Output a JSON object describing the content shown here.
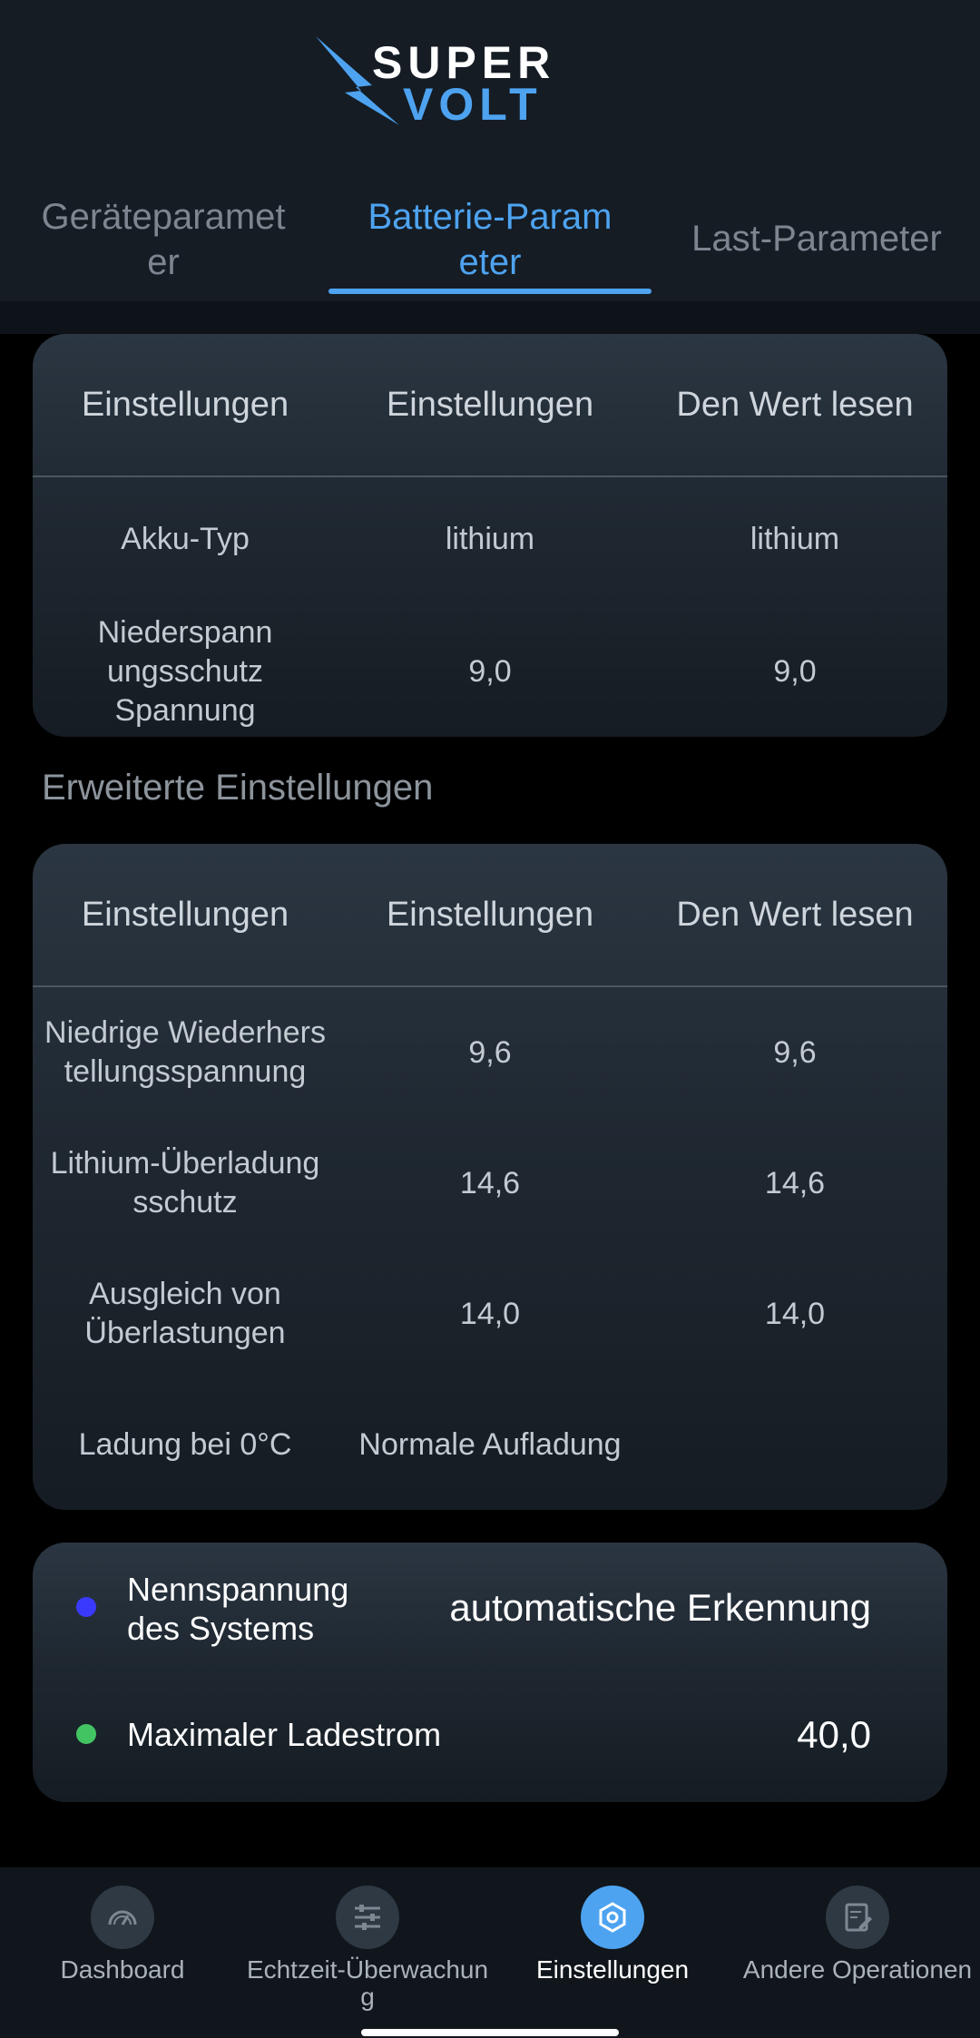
{
  "colors": {
    "accent": "#4ea3f0",
    "header_bg": "#151c24",
    "page_bg": "#000000",
    "dot_voltage": "#3a3aff",
    "dot_current": "#43c463"
  },
  "header": {
    "logo_text": "SUPER VOLT",
    "tabs": [
      {
        "label": "Geräteparameter",
        "line1": "Geräteparamet",
        "line2": "er",
        "active": false
      },
      {
        "label": "Batterie-Parameter",
        "line1": "Batterie-Param",
        "line2": "eter",
        "active": true
      },
      {
        "label": "Last-Parameter",
        "line1": "Last-Parameter",
        "line2": "",
        "active": false
      }
    ]
  },
  "basic_table": {
    "headers": [
      "Einstellungen",
      "Einstellungen",
      "Den Wert lesen"
    ],
    "rows": [
      {
        "name": "Akku-Typ",
        "setting": "lithium",
        "read": "lithium"
      },
      {
        "name": "Niederspann ungsschutz Spannung",
        "name_lines": [
          "Niederspann",
          "ungsschutz",
          "Spannung"
        ],
        "setting": "9,0",
        "read": "9,0"
      }
    ]
  },
  "advanced_section": {
    "title": "Erweiterte Einstellungen"
  },
  "advanced_table": {
    "headers": [
      "Einstellungen",
      "Einstellungen",
      "Den Wert lesen"
    ],
    "rows": [
      {
        "name_lines": [
          "Niedrige Wiederhers",
          "tellungsspannung"
        ],
        "setting": "9,6",
        "read": "9,6"
      },
      {
        "name_lines": [
          "Lithium-Überladung",
          "sschutz"
        ],
        "setting": "14,6",
        "read": "14,6"
      },
      {
        "name_lines": [
          "Ausgleich von",
          "Überlastungen"
        ],
        "setting": "14,0",
        "read": "14,0"
      },
      {
        "name_lines": [
          "Ladung bei 0°C"
        ],
        "setting": "Normale Aufladung",
        "read": ""
      }
    ]
  },
  "system_info": {
    "voltage_label_lines": [
      "Nennspannung",
      "des Systems"
    ],
    "voltage_value": "automatische Erkennung",
    "current_label": "Maximaler Ladestrom",
    "current_value": "40,0"
  },
  "bottom_nav": [
    {
      "label": "Dashboard",
      "icon": "gauge-icon",
      "active": false
    },
    {
      "label_lines": [
        "Echtzeit-Überwachun",
        "g"
      ],
      "icon": "sliders-icon",
      "active": false
    },
    {
      "label": "Einstellungen",
      "icon": "settings-hex-icon",
      "active": true
    },
    {
      "label": "Andere Operationen",
      "icon": "edit-document-icon",
      "active": false
    }
  ]
}
